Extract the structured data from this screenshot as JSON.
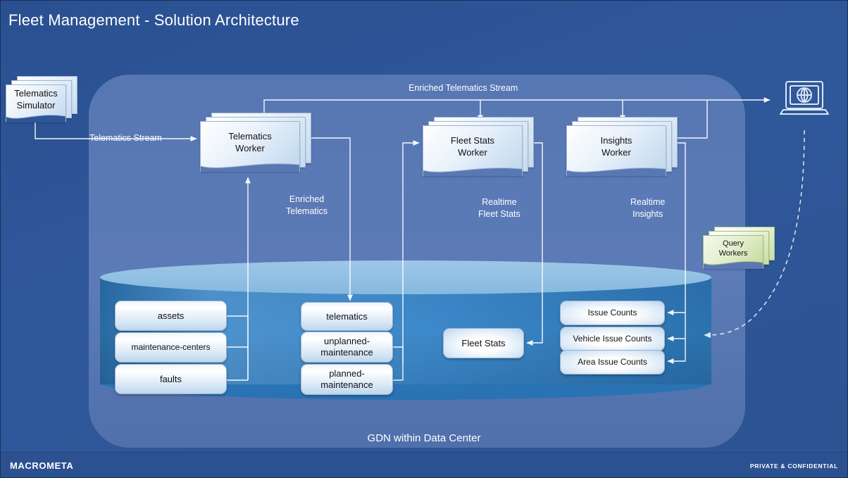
{
  "page": {
    "title": "Fleet Management - Solution Architecture",
    "background_color": "#2c5391"
  },
  "footer": {
    "logo": "MACROMETA",
    "confidential": "PRIVATE & CONFIDENTIAL"
  },
  "container": {
    "label": "GDN within Data Center",
    "color": "#5878b4"
  },
  "sources": {
    "simulator": {
      "line1": "Telematics",
      "line2": "Simulator"
    },
    "query_workers": {
      "line1": "Query",
      "line2": "Workers",
      "color": "#c9dfa2"
    }
  },
  "workers": [
    {
      "id": "telematics-worker",
      "line1": "Telematics",
      "line2": "Worker"
    },
    {
      "id": "fleet-stats-worker",
      "line1": "Fleet Stats",
      "line2": "Worker"
    },
    {
      "id": "insights-worker",
      "line1": "Insights",
      "line2": "Worker"
    }
  ],
  "flows": {
    "telematics_stream": "Telematics Stream",
    "enriched_telematics_stream": "Enriched Telematics Stream",
    "enriched_telematics_l1": "Enriched",
    "enriched_telematics_l2": "Telematics",
    "realtime_fleet_stats_l1": "Realtime",
    "realtime_fleet_stats_l2": "Fleet Stats",
    "realtime_insights_l1": "Realtime",
    "realtime_insights_l2": "Insights"
  },
  "collections": {
    "left": [
      {
        "label": "assets"
      },
      {
        "label": "maintenance-centers"
      },
      {
        "label": "faults"
      }
    ],
    "middle": [
      {
        "label": "telematics"
      },
      {
        "label": "unplanned-\nmaintenance",
        "l1": "unplanned-",
        "l2": "maintenance"
      },
      {
        "label": "planned-\nmaintenance",
        "l1": "planned-",
        "l2": "maintenance"
      }
    ],
    "stats": [
      {
        "label": "Fleet Stats"
      }
    ],
    "right": [
      {
        "label": "Issue Counts"
      },
      {
        "label": "Vehicle Issue Counts"
      },
      {
        "label": "Area Issue Counts"
      }
    ]
  },
  "icons": {
    "laptop": "laptop-globe-icon"
  }
}
